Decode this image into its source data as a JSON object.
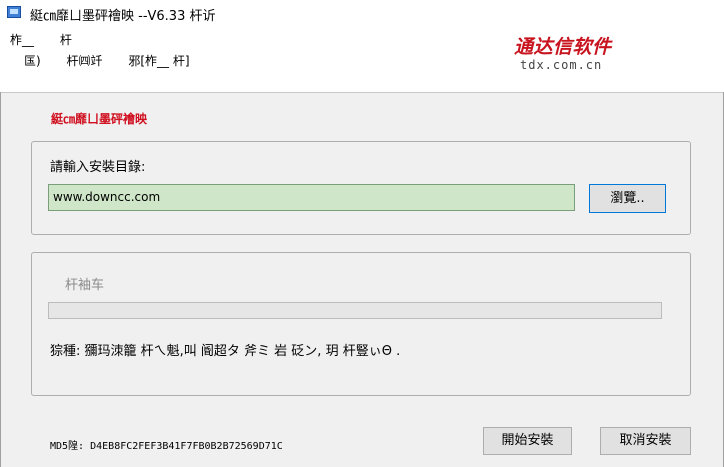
{
  "window": {
    "title": "綎㎝靡ㄩ墨砰襘映  --V6.33  杆䜣"
  },
  "header": {
    "menu_row1": [
      "柞__",
      "杆"
    ],
    "menu_row2": [
      "匤)",
      "杆㈣竏",
      "邪[柞__  杆]"
    ],
    "logo_cn": "通达信软件",
    "logo_url": "tdx.com.cn"
  },
  "main": {
    "subtitle": "綎㎝靡ㄩ墨砰襘映",
    "install_path": {
      "label": "請輸入安裝目錄:",
      "value": "www.downcc.com",
      "browse_label": "瀏覽.."
    },
    "progress": {
      "label": "杆袖车",
      "percent": 0
    },
    "status_text": "猔種:  獼玛洓籠   杆ㄟ魁,叫   阍超タ   斧ミ   岩   砭ン,  玥   杆豎ぃΘ    ."
  },
  "footer": {
    "md5_label": "MD5隍:",
    "md5_value": "D4EB8FC2FEF3B41F7FB0B2B72569D71C",
    "start_label": "開始安裝",
    "cancel_label": "取消安裝"
  },
  "colors": {
    "accent_red": "#d01020",
    "input_bg": "#cfe6c8",
    "focus_border": "#0078d7"
  }
}
